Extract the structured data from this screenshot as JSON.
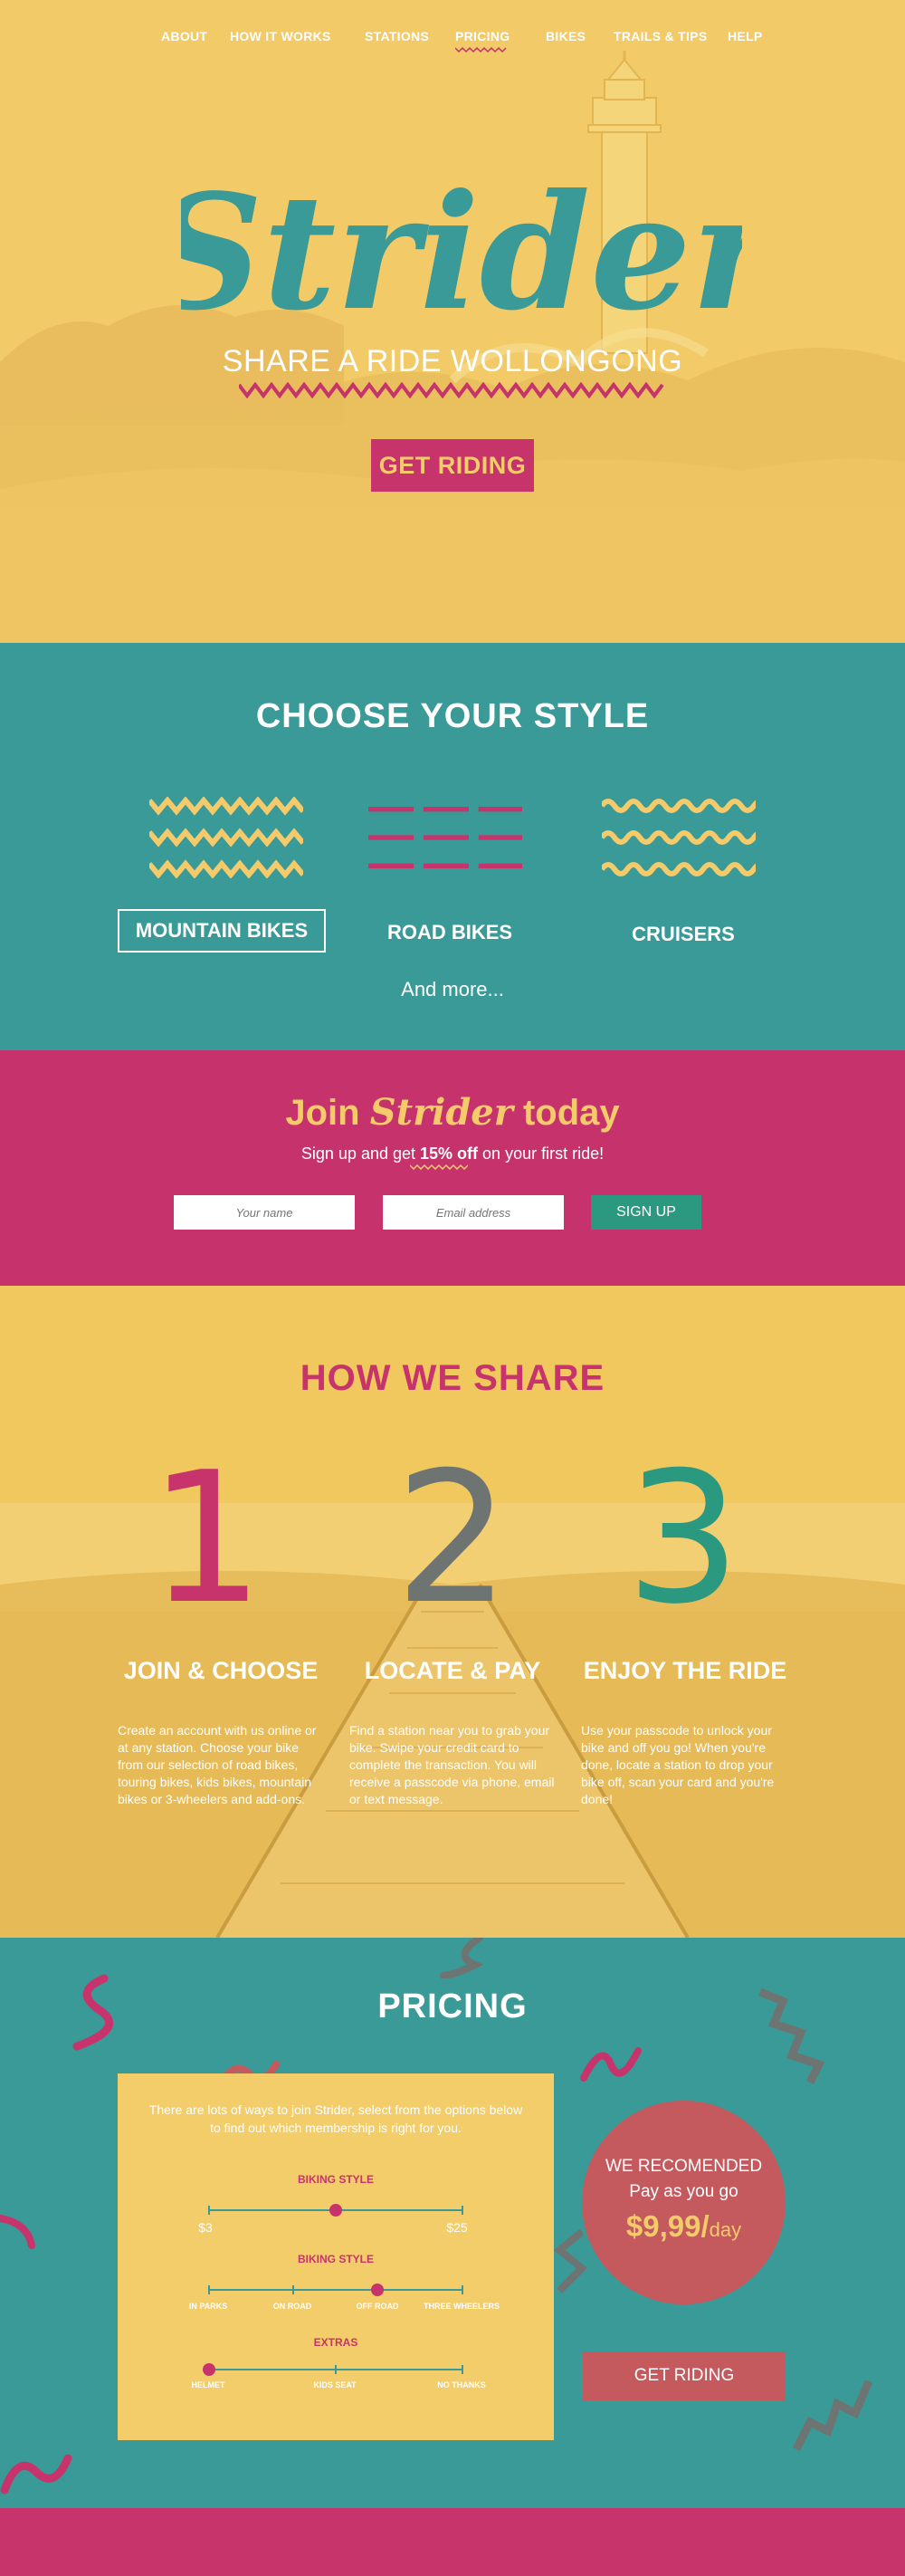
{
  "nav": {
    "items": [
      {
        "label": "ABOUT"
      },
      {
        "label": "HOW IT WORKS"
      },
      {
        "label": "STATIONS"
      },
      {
        "label": "PRICING"
      },
      {
        "label": "BIKES"
      },
      {
        "label": "TRAILS & TIPS"
      },
      {
        "label": "HELP"
      }
    ],
    "active": "PRICING"
  },
  "hero": {
    "brand": "Strider",
    "tagline": "SHARE A RIDE WOLLONGONG",
    "cta": "GET RIDING"
  },
  "styles": {
    "title": "CHOOSE YOUR STYLE",
    "items": [
      {
        "label": "MOUNTAIN BIKES",
        "icon": "zigzag-lines-icon"
      },
      {
        "label": "ROAD BIKES",
        "icon": "dashed-lines-icon"
      },
      {
        "label": "CRUISERS",
        "icon": "wavy-lines-icon"
      }
    ],
    "more": "And more..."
  },
  "join": {
    "title_prefix": "Join",
    "title_brand": "Strider",
    "title_suffix": "today",
    "sub_before": "Sign up and get",
    "sub_bold": "15% off",
    "sub_after": "on your first ride!",
    "name_placeholder": "Your name",
    "email_placeholder": "Email address",
    "button": "SIGN UP"
  },
  "how": {
    "title": "HOW WE SHARE",
    "steps": [
      {
        "num": "1",
        "title": "JOIN & CHOOSE",
        "text": "Create an account with us online or at any station. Choose your bike from our selection of road bikes, touring bikes, kids bikes, mountain bikes or 3-wheelers and add-ons.",
        "color": "#c6346b"
      },
      {
        "num": "2",
        "title": "LOCATE & PAY",
        "text": "Find a station near you to grab your bike. Swipe your credit card to complete the transaction. You will receive a passcode via phone, email or text message.",
        "color": "#6e7472"
      },
      {
        "num": "3",
        "title": "ENJOY THE RIDE",
        "text": "Use your passcode to unlock your bike and off you go! When you're done, locate a station to drop your bike off, scan your card and you're done!",
        "color": "#2b9980"
      }
    ]
  },
  "pricing": {
    "title": "PRICING",
    "intro": "There are lots of ways to join Strider, select from the options below to find out which membership is right for you.",
    "slider1": {
      "title": "BIKING STYLE",
      "min": "$3",
      "max": "$25",
      "value": 0.5
    },
    "slider2": {
      "title": "BIKING STYLE",
      "options": [
        "IN PARKS",
        "ON ROAD",
        "OFF ROAD",
        "THREE WHEELERS"
      ],
      "selected": "OFF ROAD"
    },
    "slider3": {
      "title": "EXTRAS",
      "options": [
        "HELMET",
        "KIDS SEAT",
        "NO THANKS"
      ],
      "selected": "HELMET"
    },
    "rec_title": "WE RECOMENDED",
    "rec_sub": "Pay as you go",
    "rec_price": "$9,99/",
    "rec_unit": "day",
    "cta": "GET RIDING"
  },
  "colors": {
    "yellow": "#f2ca68",
    "teal": "#3a9a97",
    "magenta": "#c6346b",
    "green": "#2b9980"
  }
}
